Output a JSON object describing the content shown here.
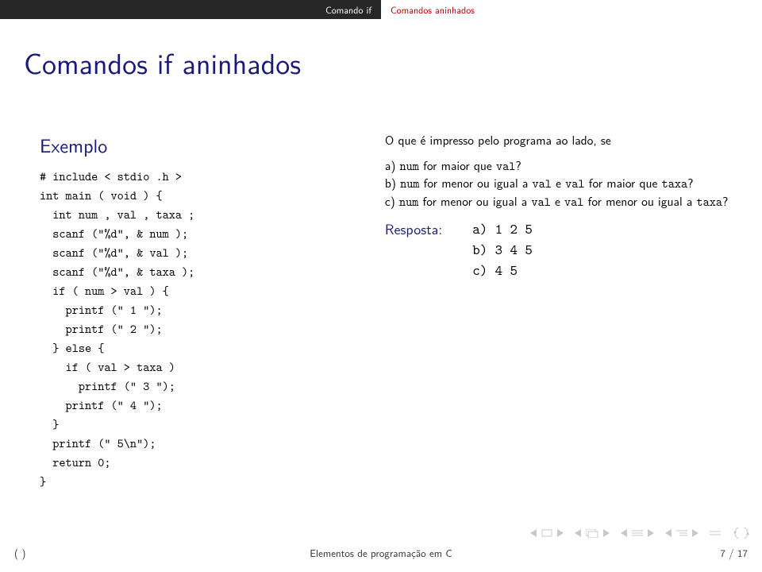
{
  "tabs": {
    "left": "Comando if",
    "right": "Comandos aninhados"
  },
  "title": "Comandos if aninhados",
  "example_label": "Exemplo",
  "code": "# include < stdio .h >\nint main ( void ) {\n  int num , val , taxa ;\n  scanf (\"%d\", & num );\n  scanf (\"%d\", & val );\n  scanf (\"%d\", & taxa );\n  if ( num > val ) {\n    printf (\" 1 \");\n    printf (\" 2 \");\n  } else {\n    if ( val > taxa )\n      printf (\" 3 \");\n    printf (\" 4 \");\n  }\n  printf (\" 5\\n\");\n  return 0;\n}",
  "q": {
    "intro": "O que é impresso pelo programa ao lado, se",
    "a_pre": "a) ",
    "a_mid1": "num",
    "a_mid2": " for maior que ",
    "a_mid3": "val",
    "a_end": "?",
    "b_pre": "b) ",
    "b1": "num",
    "b2": " for menor ou igual a ",
    "b3": "val",
    "b4": " e ",
    "b5": "val",
    "b6": " for maior que ",
    "b7": "taxa",
    "b_end": "?",
    "c_pre": "c) ",
    "c1": "num",
    "c2": " for menor ou igual a ",
    "c3": "val",
    "c4": " e ",
    "c5": "val",
    "c6": " for menor ou igual a ",
    "c7": "taxa",
    "c_end": "?"
  },
  "resposta_label": "Resposta:",
  "answers": {
    "a": "a) 1 2 5",
    "b": "b) 3 4 5",
    "c": "c) 4 5"
  },
  "footer": {
    "left": "( )",
    "center": "Elementos de programação em C",
    "right": "7 / 17"
  }
}
